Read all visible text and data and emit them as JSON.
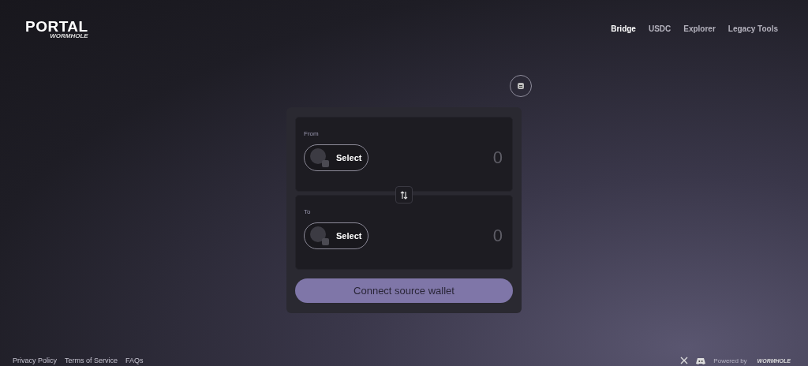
{
  "logo": {
    "title": "PORTAL",
    "subtitle": "WORMHOLE"
  },
  "nav": [
    {
      "label": "Bridge",
      "selected": true
    },
    {
      "label": "USDC",
      "selected": false
    },
    {
      "label": "Explorer",
      "selected": false
    },
    {
      "label": "Legacy Tools",
      "selected": false
    }
  ],
  "panels": [
    {
      "label": "From",
      "select": "Select",
      "amount": "0"
    },
    {
      "label": "To",
      "select": "Select",
      "amount": "0"
    }
  ],
  "connect_button": "Connect source wallet",
  "footer": {
    "links": [
      "Privacy Policy",
      "Terms of Service",
      "FAQs"
    ],
    "powered_by": "Powered by",
    "brand": "WORMHOLE"
  }
}
